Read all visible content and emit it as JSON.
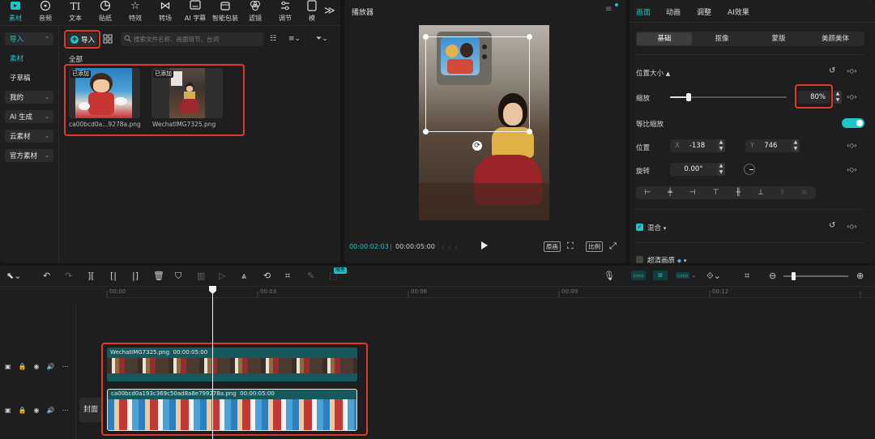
{
  "toolbar": {
    "items": [
      {
        "label": "素材",
        "icon": "media-icon",
        "active": true
      },
      {
        "label": "音频",
        "icon": "audio-icon"
      },
      {
        "label": "文本",
        "icon": "text-icon"
      },
      {
        "label": "贴纸",
        "icon": "sticker-icon"
      },
      {
        "label": "特效",
        "icon": "effects-icon"
      },
      {
        "label": "转场",
        "icon": "transition-icon"
      },
      {
        "label": "AI 字幕",
        "icon": "ai-caption-icon"
      },
      {
        "label": "智能包装",
        "icon": "smart-pack-icon"
      },
      {
        "label": "滤镜",
        "icon": "filter-icon"
      },
      {
        "label": "调节",
        "icon": "adjust-icon"
      },
      {
        "label": "模",
        "icon": "template-icon"
      }
    ],
    "more_icon_glyph": "≫"
  },
  "sidebar": {
    "items": [
      {
        "label": "导入",
        "chev": "⌃",
        "style": "box-active"
      },
      {
        "label": "素材",
        "style": "active-text"
      },
      {
        "label": "子草稿",
        "style": "plain"
      },
      {
        "label": "我的",
        "chev": "⌄",
        "style": "box"
      },
      {
        "label": "AI 生成",
        "chev": "⌄",
        "style": "box"
      },
      {
        "label": "云素材",
        "chev": "⌄",
        "style": "box"
      },
      {
        "label": "官方素材",
        "chev": "⌄",
        "style": "box"
      }
    ]
  },
  "media": {
    "import_label": "导入",
    "search_placeholder": "搜索文件名称、画面情节、台词",
    "section_label": "全部",
    "added_badge": "已添加",
    "files": [
      {
        "name": "ca00bcd0a...9278a.png"
      },
      {
        "name": "WechatIMG7325.png"
      }
    ]
  },
  "player": {
    "title": "播放器",
    "current_time": "00:00:02:03",
    "total_time": "00:00:05:00",
    "original_label": "原画",
    "ratio_label": "比例"
  },
  "inspector": {
    "tabs": [
      "画面",
      "动画",
      "调整",
      "AI效果"
    ],
    "subtabs": [
      "基础",
      "抠像",
      "蒙版",
      "美颜美体"
    ],
    "position_size_label": "位置大小",
    "scale_label": "缩放",
    "scale_value": "80%",
    "scale_fraction": 0.16,
    "uniform_scale_label": "等比缩放",
    "position_label": "位置",
    "x_label": "X",
    "x_value": "-138",
    "y_label": "Y",
    "y_value": "746",
    "rotation_label": "旋转",
    "rotation_value": "0.00°",
    "blend_label": "混合",
    "hd_label": "超清画质"
  },
  "timeline": {
    "new_badge": "限免",
    "ruler": [
      "00:00",
      "00:03",
      "00:06",
      "00:09",
      "00:12"
    ],
    "cover_label": "封面",
    "clips": [
      {
        "name": "WechatIMG7325.png",
        "duration": "00:00:05:00"
      },
      {
        "name": "ca00bcd0a193c369c50ad8a8e799278a.png",
        "duration": "00:00:05:00"
      }
    ]
  },
  "colors": {
    "accent": "#1fc5c8",
    "highlight": "#e03a2f"
  }
}
